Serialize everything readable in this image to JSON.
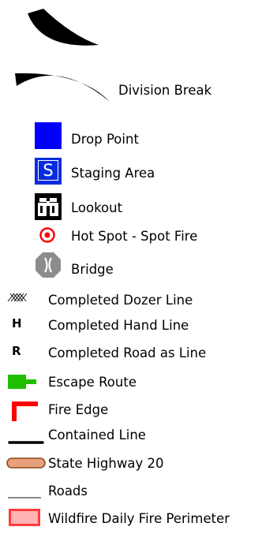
{
  "legend": {
    "items": [
      {
        "label": "Division Break",
        "icon": "division-break-arcs"
      },
      {
        "label": "Drop Point",
        "icon": "blue-square"
      },
      {
        "label": "Staging Area",
        "icon": "staging-s-square",
        "symbol_text": "S"
      },
      {
        "label": "Lookout",
        "icon": "binoculars-icon"
      },
      {
        "label": "Hot Spot - Spot Fire",
        "icon": "red-target-circle"
      },
      {
        "label": "Bridge",
        "icon": "bridge-octagon"
      },
      {
        "label": "Completed Dozer Line",
        "icon": "crosshatch-line"
      },
      {
        "label": "Completed Hand Line",
        "icon": "letter-h",
        "symbol_text": "H"
      },
      {
        "label": "Completed Road as Line",
        "icon": "letter-r",
        "symbol_text": "R"
      },
      {
        "label": "Escape Route",
        "icon": "green-arrow-flag"
      },
      {
        "label": "Fire Edge",
        "icon": "red-elbow-line"
      },
      {
        "label": "Contained Line",
        "icon": "black-thick-line"
      },
      {
        "label": "State Highway 20",
        "icon": "orange-capsule"
      },
      {
        "label": "Roads",
        "icon": "gray-thin-line"
      },
      {
        "label": "Wildfire Daily Fire Perimeter",
        "icon": "pink-outlined-rectangle"
      }
    ]
  },
  "colors": {
    "drop_point": "#0000ff",
    "staging_area": "#0a2ce0",
    "hot_spot": "#ff0000",
    "bridge": "#8c8c8c",
    "escape_route": "#1fbf00",
    "fire_edge": "#ff0000",
    "contained_line": "#000000",
    "state_highway_fill": "#e8a07a",
    "state_highway_outline": "#8a4a20",
    "roads": "#7a7a7a",
    "perimeter_fill": "#ffb3b3",
    "perimeter_outline": "#ff3b3b"
  }
}
